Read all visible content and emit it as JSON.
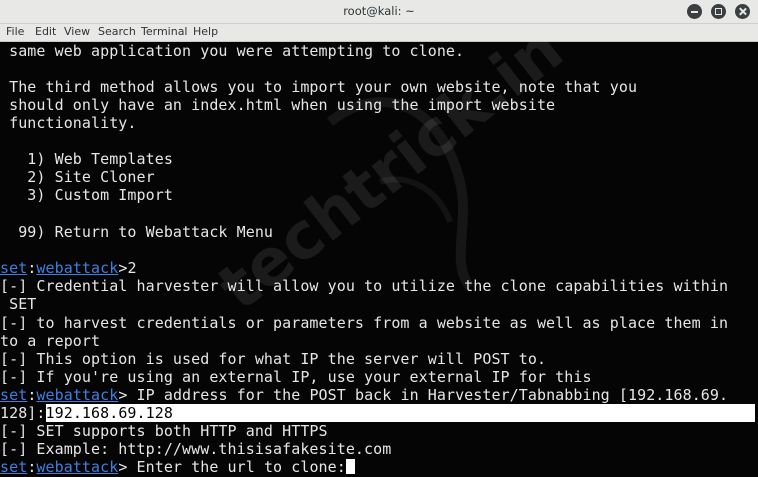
{
  "window": {
    "title": "root@kali: ~"
  },
  "menu": [
    "File",
    "Edit",
    "View",
    "Search",
    "Terminal",
    "Help"
  ],
  "watermark": "techtrick.in",
  "prompt": {
    "app": "set",
    "module": "webattack"
  },
  "lines": {
    "l1": " same web application you were attempting to clone.",
    "l2": " The third method allows you to import your own website, note that you",
    "l3": " should only have an index.html when using the import website",
    "l4": " functionality.",
    "l5": "   1) Web Templates",
    "l6": "   2) Site Cloner",
    "l7": "   3) Custom Import",
    "l8": "  99) Return to Webattack Menu",
    "l9": ">2",
    "l10": "[-] Credential harvester will allow you to utilize the clone capabilities within",
    "l11": " SET",
    "l12": "[-] to harvest credentials or parameters from a website as well as place them in",
    "l13": "to a report",
    "l14": "[-] This option is used for what IP the server will POST to.",
    "l15": "[-] If you're using an external IP, use your external IP for this",
    "l16": "> IP address for the POST back in Harvester/Tabnabbing [192.168.69.",
    "l17a": "128]:",
    "l17b": "192.168.69.128",
    "l18": "[-] SET supports both HTTP and HTTPS",
    "l19": "[-] Example: http://www.thisisafakesite.com",
    "l20": "> Enter the url to clone:"
  }
}
